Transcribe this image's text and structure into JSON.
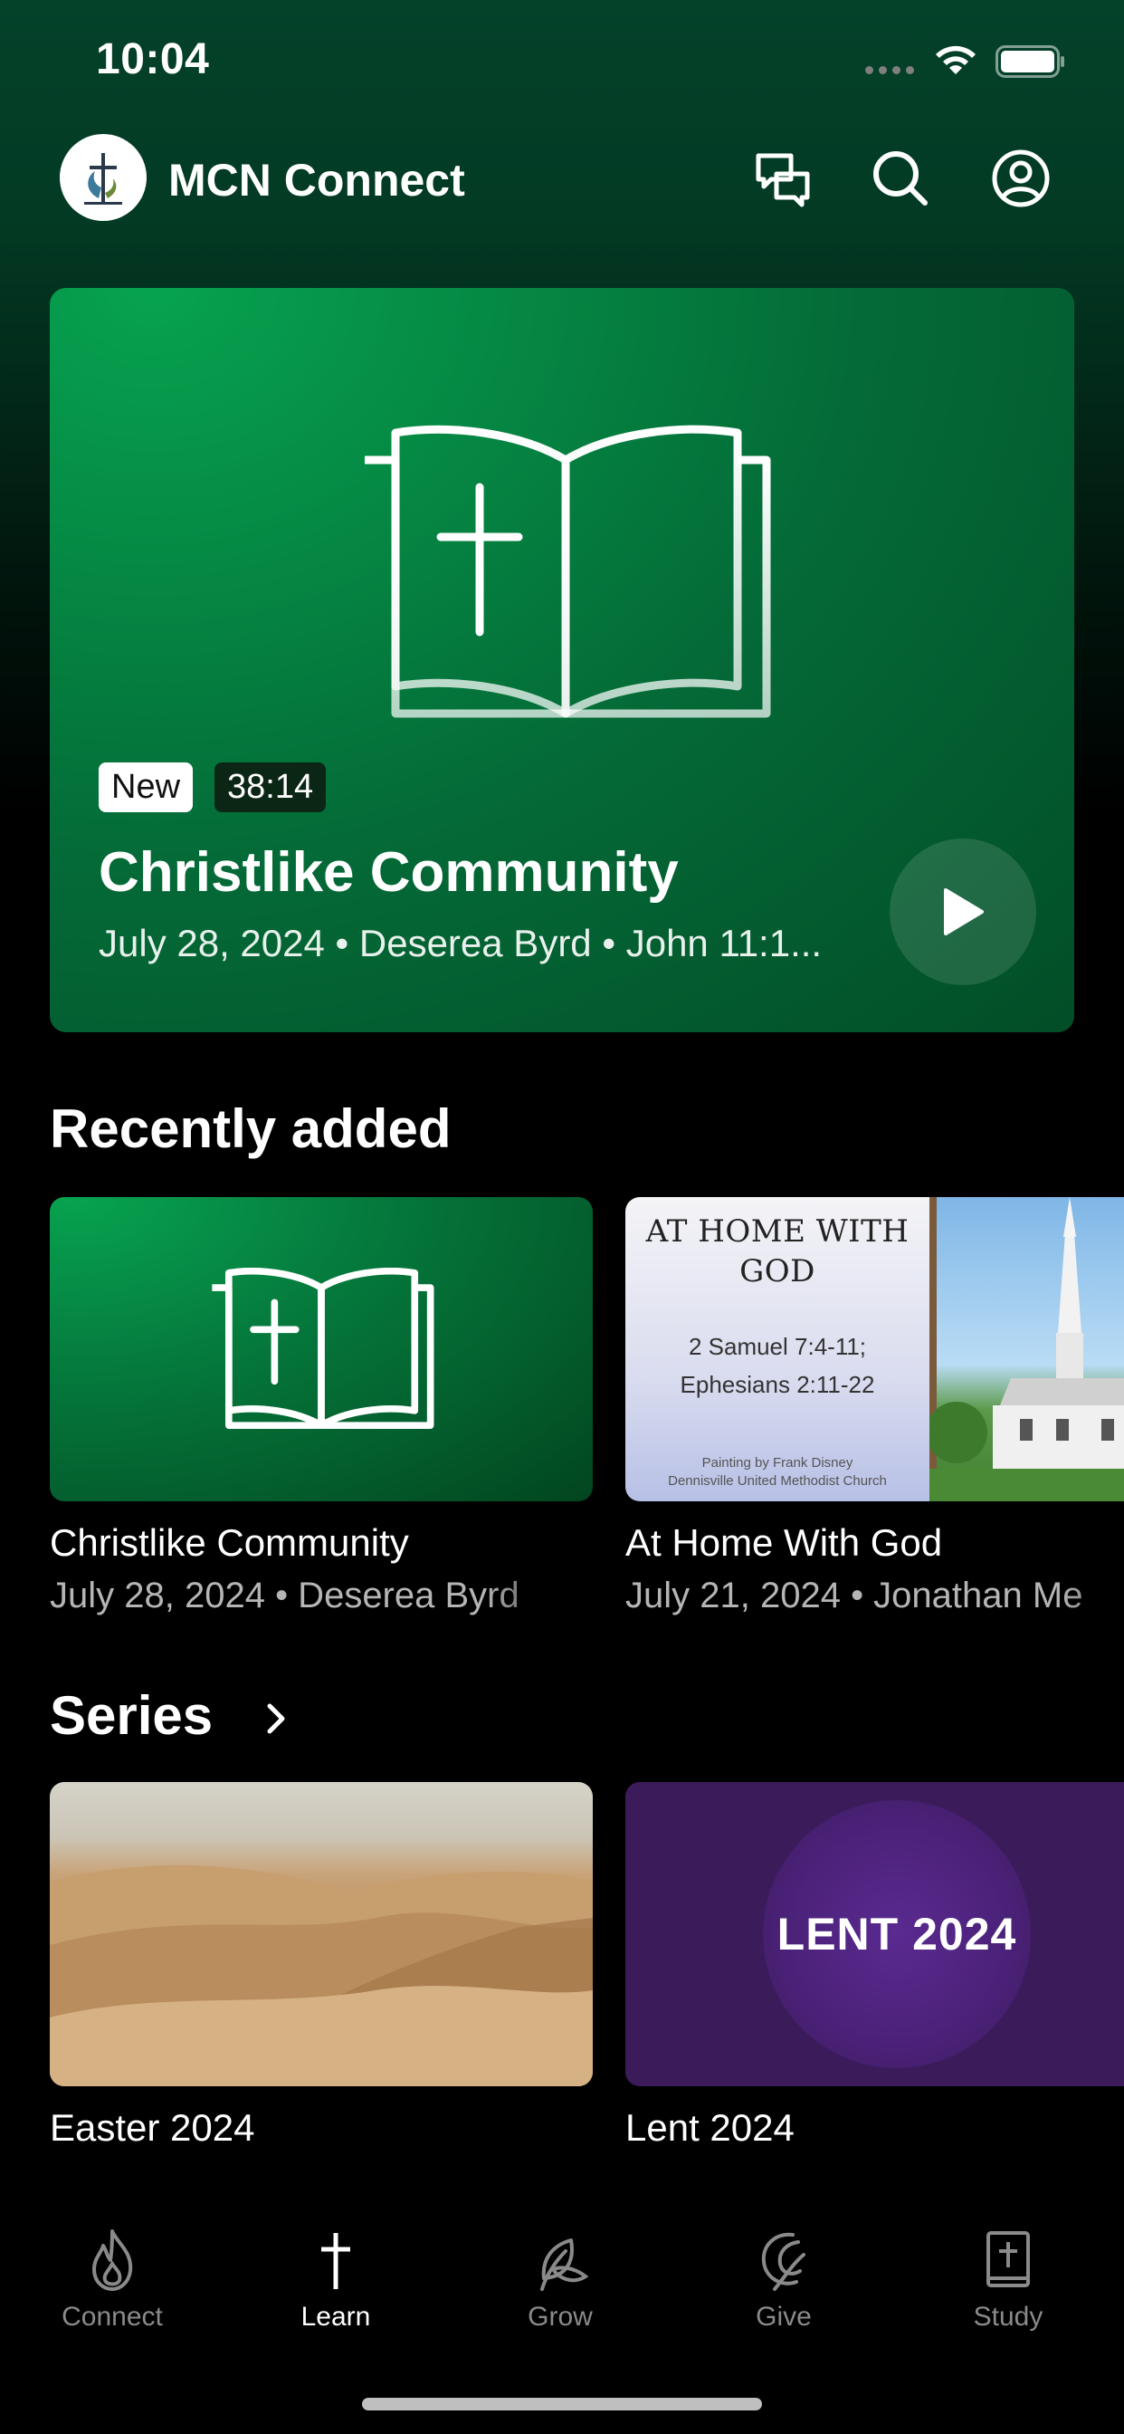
{
  "status_bar": {
    "time": "10:04"
  },
  "header": {
    "app_title": "MCN Connect"
  },
  "hero": {
    "badge_new": "New",
    "duration": "38:14",
    "title": "Christlike Community",
    "meta": "July 28, 2024 • Deserea Byrd • John 11:1..."
  },
  "recently_added": {
    "title": "Recently added",
    "items": [
      {
        "title": "Christlike Community",
        "meta": "July 28, 2024 • Deserea Byrd"
      },
      {
        "title": "At Home With God",
        "meta": "July 21, 2024 • Jonathan Me",
        "thumb_heading": "AT HOME WITH GOD",
        "thumb_verse_1": "2 Samuel 7:4-11;",
        "thumb_verse_2": "Ephesians 2:11-22",
        "thumb_credit_1": "Painting by Frank Disney",
        "thumb_credit_2": "Dennisville United Methodist Church"
      }
    ]
  },
  "series": {
    "title": "Series",
    "items": [
      {
        "title": "Easter 2024"
      },
      {
        "title": "Lent 2024",
        "thumb_text": "LENT 2024"
      }
    ]
  },
  "tabs": [
    {
      "label": "Connect",
      "icon": "flame-icon",
      "active": false
    },
    {
      "label": "Learn",
      "icon": "cross-icon",
      "active": true
    },
    {
      "label": "Grow",
      "icon": "leaf-icon",
      "active": false
    },
    {
      "label": "Give",
      "icon": "give-icon",
      "active": false
    },
    {
      "label": "Study",
      "icon": "bible-icon",
      "active": false
    }
  ],
  "colors": {
    "brand_green": "#058a44",
    "lent_purple": "#3c1b5a",
    "tab_inactive": "#8a8a8a"
  }
}
